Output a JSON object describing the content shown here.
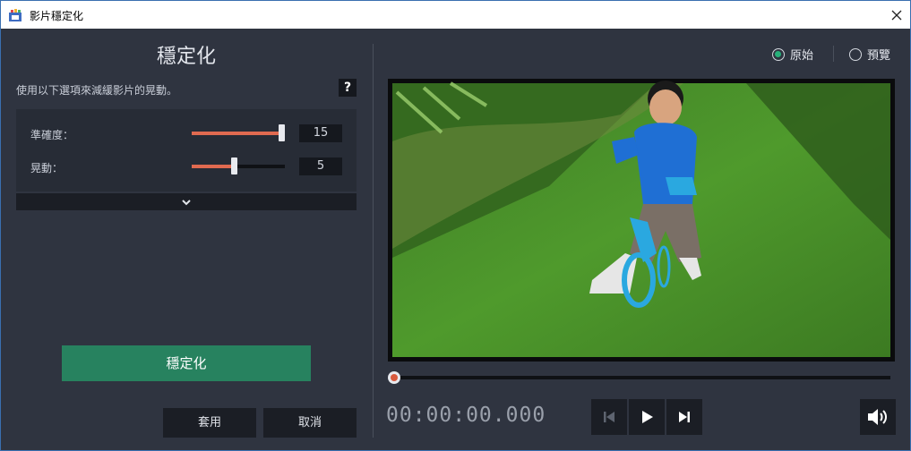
{
  "window": {
    "title": "影片穩定化"
  },
  "panel": {
    "title": "穩定化",
    "instruction": "使用以下選項來減緩影片的晃動。",
    "help_label": "?"
  },
  "settings": {
    "accuracy": {
      "label": "準確度：",
      "value": "15",
      "fraction": 1.0
    },
    "shake": {
      "label": "晃動：",
      "value": "5",
      "fraction": 0.45
    }
  },
  "buttons": {
    "stabilize": "穩定化",
    "apply": "套用",
    "cancel": "取消"
  },
  "view_mode": {
    "original": "原始",
    "preview": "預覽",
    "selected": "original"
  },
  "playback": {
    "timecode": "00:00:00.000",
    "progress": 0.0
  },
  "colors": {
    "accent_green": "#27825f",
    "slider_fill": "#e06a50",
    "radio_selected": "#27b07a"
  },
  "icons": {
    "app": "app-icon",
    "close": "close-icon",
    "expand": "chevron-down-icon",
    "prev": "skip-back-icon",
    "play": "play-icon",
    "next": "skip-forward-icon",
    "volume": "volume-icon"
  }
}
